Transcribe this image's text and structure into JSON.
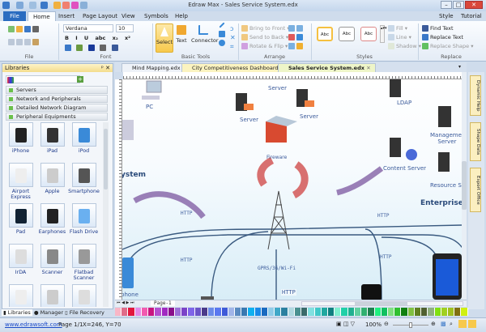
{
  "window": {
    "title": "Edraw Max - Sales Service System.edx",
    "controls": [
      "–",
      "□",
      "✕"
    ]
  },
  "menu": {
    "tabs": [
      "File",
      "Home",
      "Insert",
      "Page Layout",
      "View",
      "Symbols",
      "Help"
    ],
    "active": "Home",
    "right": [
      "Style",
      "Tutorial"
    ]
  },
  "ribbon": {
    "file_group": "File",
    "font": {
      "family": "Verdana",
      "size": "10",
      "label": "Font",
      "format_buttons": [
        "B",
        "I",
        "U",
        "abc",
        "x₂",
        "x²"
      ]
    },
    "basic_tools": {
      "label": "Basic Tools",
      "select": "Select",
      "text": "Text",
      "connector": "Connector"
    },
    "arrange": {
      "label": "Arrange",
      "bring_front": "Bring to Front",
      "send_back": "Send to Back",
      "rotate": "Rotate & Flip"
    },
    "styles": {
      "label": "Styles",
      "samples": [
        "Abc",
        "Abc",
        "Abc"
      ],
      "fill": "Fill",
      "line": "Line",
      "shadow": "Shadow"
    },
    "replace": {
      "label": "Replace",
      "find": "Find Text",
      "replace_text": "Replace Text",
      "replace_shape": "Replace Shape"
    }
  },
  "libraries": {
    "title": "Libraries",
    "categories": [
      "Servers",
      "Network and Peripherals",
      "Detailed Network Diagram",
      "Peripheral Equipments"
    ],
    "items": [
      "iPhone",
      "iPad",
      "iPod",
      "Airport Express",
      "Apple",
      "Smartphone",
      "Pad",
      "Earphones",
      "Flash Drive",
      "IrDA",
      "Scanner",
      "Flatbad Scanner",
      "",
      "",
      ""
    ],
    "bottom_tabs": [
      "Libraries",
      "Manager",
      "File Recovery"
    ]
  },
  "doc_tabs": [
    {
      "label": "Mind Mapping.edx"
    },
    {
      "label": "City Competitiveness Dashboard.edx"
    },
    {
      "label": "Sales Service System.edx",
      "active": true
    }
  ],
  "diagram": {
    "labels": {
      "pc": "PC",
      "server_top": "Server",
      "server1": "Server",
      "server2": "Server",
      "ldap": "LDAP",
      "management": "Managemer\nServer",
      "firewall": "Fireware",
      "content": "Content Server",
      "resource": "Resource Se",
      "title_left": "ystem",
      "title_right": "Enterprise S",
      "tower": "GPRS/3G/Wi-Fi",
      "phone": "phone"
    },
    "http_labels": [
      "HTTP",
      "HTTP",
      "HTTP",
      "HTTP",
      "HTTP"
    ]
  },
  "right_panel": [
    "Dynamic Help",
    "Shape Data",
    "Export Office"
  ],
  "page_tab": "Page-1",
  "palette": [
    "#f9b6c6",
    "#e06c8a",
    "#e2163d",
    "#e68ae8",
    "#f25bb0",
    "#c9157f",
    "#b44fd0",
    "#a12ac2",
    "#8a0f8a",
    "#9b6fd8",
    "#7b43c8",
    "#7f64e8",
    "#6b54c8",
    "#4b3a8a",
    "#6a8ae8",
    "#5a78f0",
    "#3f5ad8",
    "#a0b4e8",
    "#5a8ac0",
    "#3a78b0",
    "#10b0f0",
    "#1a8ae8",
    "#1a6ac0",
    "#90cce8",
    "#40a8c8",
    "#2a80a0",
    "#b0d8e0",
    "#4a9090",
    "#3a6a6a",
    "#80e0e0",
    "#40c8c8",
    "#20a8a0",
    "#108080",
    "#80f0d0",
    "#20d0a8",
    "#20b090",
    "#60d0a0",
    "#30b070",
    "#208050",
    "#20f080",
    "#10c060",
    "#80e080",
    "#30c030",
    "#108010",
    "#80c040",
    "#608020",
    "#506030",
    "#90b080",
    "#80e010",
    "#a0d020",
    "#a0c020",
    "#807010",
    "#d0f010"
  ],
  "status": {
    "link": "www.edrawsoft.com",
    "page": "Page 1/1",
    "coords": "X=246, Y=70",
    "zoom": "100%"
  }
}
